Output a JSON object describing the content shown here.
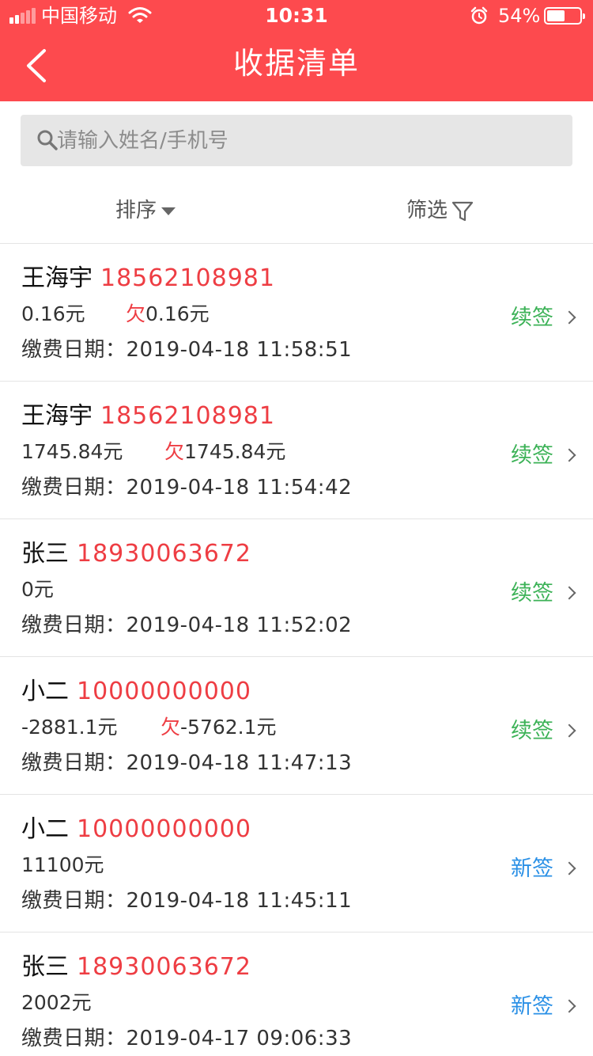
{
  "status_bar": {
    "carrier": "中国移动",
    "time": "10:31",
    "battery": "54%",
    "battery_level": 0.54
  },
  "nav": {
    "title": "收据清单"
  },
  "search": {
    "placeholder": "请输入姓名/手机号",
    "value": ""
  },
  "toolbar": {
    "sort_label": "排序",
    "filter_label": "筛选"
  },
  "colors": {
    "header": "#fd4a4e",
    "phone": "#ee3d43",
    "renew": "#3cb257",
    "new_sign": "#2a90e6"
  },
  "records": [
    {
      "name": "王海宇",
      "phone": "18562108981",
      "amount": "0.16元",
      "owe_prefix": "欠",
      "owe_value": "0.16元",
      "date_label": "缴费日期：",
      "date": "2019-04-18 11:58:51",
      "status": "续签",
      "status_kind": "renew"
    },
    {
      "name": "王海宇",
      "phone": "18562108981",
      "amount": "1745.84元",
      "owe_prefix": "欠",
      "owe_value": "1745.84元",
      "date_label": "缴费日期：",
      "date": "2019-04-18 11:54:42",
      "status": "续签",
      "status_kind": "renew"
    },
    {
      "name": "张三",
      "phone": "18930063672",
      "amount": "0元",
      "owe_prefix": "",
      "owe_value": "",
      "date_label": "缴费日期：",
      "date": "2019-04-18 11:52:02",
      "status": "续签",
      "status_kind": "renew"
    },
    {
      "name": "小二",
      "phone": "10000000000",
      "amount": "-2881.1元",
      "owe_prefix": "欠",
      "owe_value": "-5762.1元",
      "date_label": "缴费日期：",
      "date": "2019-04-18 11:47:13",
      "status": "续签",
      "status_kind": "renew"
    },
    {
      "name": "小二",
      "phone": "10000000000",
      "amount": "11100元",
      "owe_prefix": "",
      "owe_value": "",
      "date_label": "缴费日期：",
      "date": "2019-04-18 11:45:11",
      "status": "新签",
      "status_kind": "newsign"
    },
    {
      "name": "张三",
      "phone": "18930063672",
      "amount": "2002元",
      "owe_prefix": "",
      "owe_value": "",
      "date_label": "缴费日期：",
      "date": "2019-04-17 09:06:33",
      "status": "新签",
      "status_kind": "newsign"
    }
  ]
}
